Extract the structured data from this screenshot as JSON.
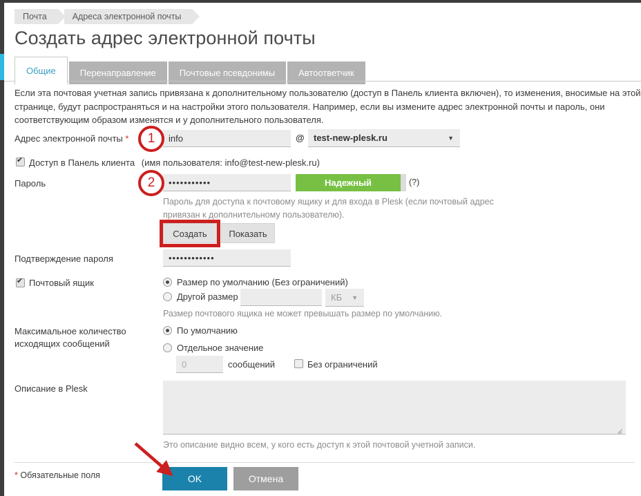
{
  "breadcrumb": {
    "items": [
      {
        "label": "Почта"
      },
      {
        "label": "Адреса электронной почты"
      }
    ]
  },
  "header": {
    "title": "Создать адрес электронной почты"
  },
  "tabs": [
    {
      "label": "Общие",
      "active": true
    },
    {
      "label": "Перенаправление",
      "active": false
    },
    {
      "label": "Почтовые псевдонимы",
      "active": false
    },
    {
      "label": "Автоответчик",
      "active": false
    }
  ],
  "intro": {
    "text": "Если эта почтовая учетная запись привязана к дополнительному пользователю (доступ в Панель клиента включен), то изменения, вносимые на этой странице, будут распространяться и на настройки этого пользователя. Например, если вы измените адрес электронной почты и пароль, они соответствующим образом изменятся и у дополнительного пользователя."
  },
  "form": {
    "email": {
      "label": "Адрес электронной почты",
      "required_mark": "*",
      "value": "info",
      "at_symbol": "@",
      "domain_selected": "test-new-plesk.ru",
      "domain_caret": "▼"
    },
    "panel_access": {
      "label": "Доступ в Панель клиента",
      "note": "(имя пользователя: info@test-new-plesk.ru)",
      "checked": true
    },
    "password": {
      "label": "Пароль",
      "value": "•••••••••••",
      "strength_label": "Надежный",
      "help_marker": "(?)",
      "hint": "Пароль для доступа к почтовому ящику и для входа в Plesk (если почтовый адрес привязан к дополнительному пользователю).",
      "generate_button": "Создать",
      "show_button": "Показать"
    },
    "password_confirm": {
      "label": "Подтверждение пароля",
      "value": "••••••••••••"
    },
    "mailbox": {
      "label": "Почтовый ящик",
      "checked": true,
      "option_default": "Размер по умолчанию (Без ограничений)",
      "option_custom": "Другой размер",
      "custom_value": "",
      "unit_selected": "КБ",
      "unit_caret": "▼",
      "hint": "Размер почтового ящика не может превышать размер по умолчанию."
    },
    "outgoing": {
      "label_line1": "Максимальное количество",
      "label_line2": "исходящих сообщений",
      "option_default": "По умолчанию",
      "option_custom": "Отдельное значение",
      "custom_value": "0",
      "unit_label": "сообщений",
      "unlimited_label": "Без ограничений",
      "unlimited_checked": false
    },
    "description": {
      "label": "Описание в Plesk",
      "value": "",
      "hint": "Это описание видно всем, у кого есть доступ к этой почтовой учетной записи."
    }
  },
  "footer": {
    "required_mark": "*",
    "required_note": "Обязательные поля",
    "ok_label": "OK",
    "cancel_label": "Отмена"
  },
  "annotations": {
    "step1": "1",
    "step2": "2"
  },
  "colors": {
    "accent": "#2fb9e0",
    "primary_button": "#1b82ab",
    "strength_green": "#77c043",
    "annotation_red": "#cc1f1f",
    "tab_inactive": "#b3b3b3",
    "required_red": "#c0392b"
  }
}
